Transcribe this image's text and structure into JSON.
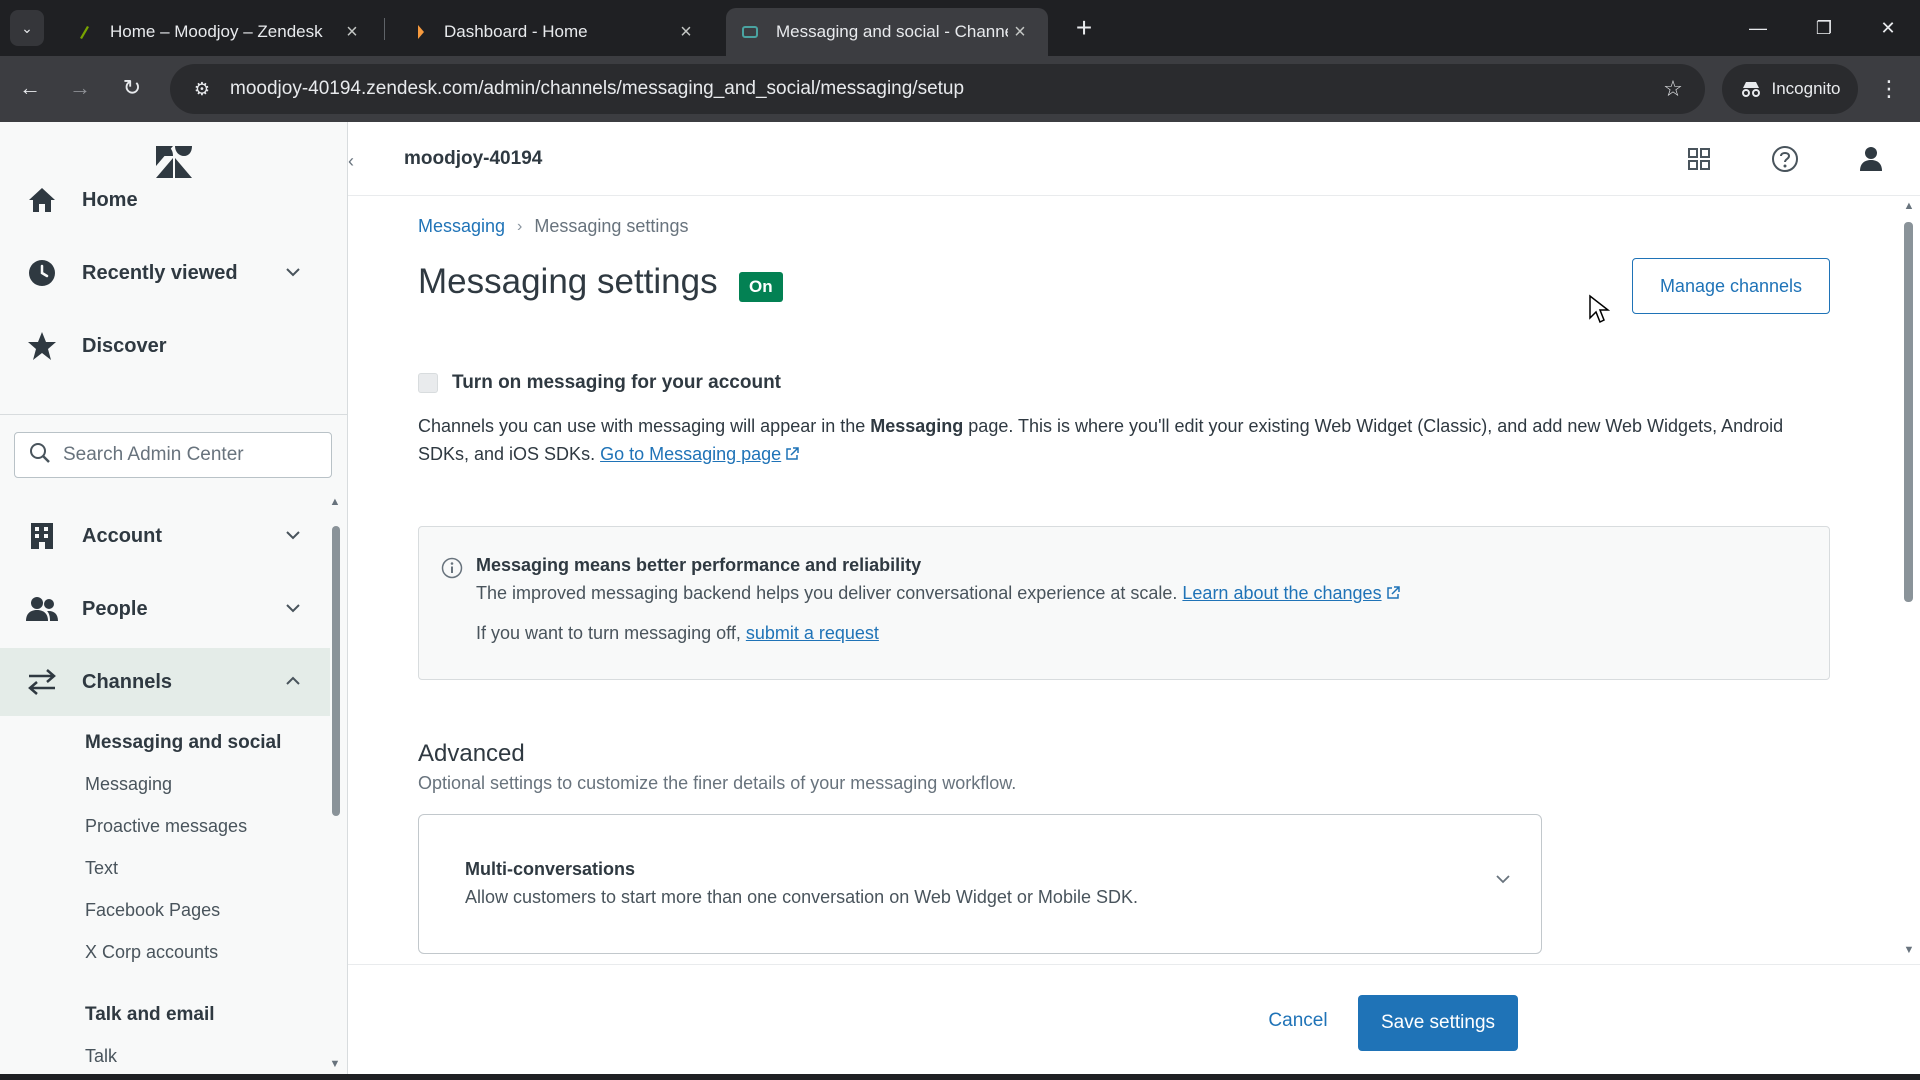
{
  "browser": {
    "tabs": [
      {
        "title": "Home – Moodjoy – Zendesk",
        "active": false
      },
      {
        "title": "Dashboard - Home",
        "active": false
      },
      {
        "title": "Messaging and social - Channe",
        "active": true
      }
    ],
    "url": "moodjoy-40194.zendesk.com/admin/channels/messaging_and_social/messaging/setup",
    "incognito_label": "Incognito"
  },
  "sidebar": {
    "nav": [
      {
        "label": "Home",
        "icon": "home-icon"
      },
      {
        "label": "Recently viewed",
        "icon": "clock-icon"
      },
      {
        "label": "Discover",
        "icon": "star-icon"
      }
    ],
    "search_placeholder": "Search Admin Center",
    "sections": [
      {
        "label": "Account",
        "icon": "building-icon"
      },
      {
        "label": "People",
        "icon": "people-icon"
      },
      {
        "label": "Channels",
        "icon": "arrows-icon",
        "expanded": true
      }
    ],
    "channels_sub": [
      {
        "label": "Messaging and social",
        "bold": true
      },
      {
        "label": "Messaging"
      },
      {
        "label": "Proactive messages"
      },
      {
        "label": "Text"
      },
      {
        "label": "Facebook Pages"
      },
      {
        "label": "X Corp accounts"
      },
      {
        "label": "Talk and email",
        "bold": true
      },
      {
        "label": "Talk"
      }
    ]
  },
  "header": {
    "subdomain": "moodjoy-40194"
  },
  "breadcrumb": {
    "parent": "Messaging",
    "current": "Messaging settings"
  },
  "page": {
    "title": "Messaging settings",
    "status_badge": "On",
    "manage_button": "Manage channels",
    "toggle_label": "Turn on messaging for your account",
    "desc_part1": "Channels you can use with messaging will appear in the ",
    "desc_bold": "Messaging",
    "desc_part2": " page. This is where you'll edit your existing Web Widget (Classic), and add new Web Widgets, Android SDKs, and iOS SDKs. ",
    "desc_link": "Go to Messaging page"
  },
  "notice": {
    "title": "Messaging means better performance and reliability",
    "body": "The improved messaging backend helps you deliver conversational experience at scale. ",
    "body_link": "Learn about the changes",
    "line2": "If you want to turn messaging off, ",
    "line2_link": "submit a request"
  },
  "advanced": {
    "title": "Advanced",
    "description": "Optional settings to customize the finer details of your messaging workflow.",
    "items": [
      {
        "title": "Multi-conversations",
        "description": "Allow customers to start more than one conversation on Web Widget or Mobile SDK."
      }
    ]
  },
  "footer": {
    "cancel": "Cancel",
    "save": "Save settings"
  },
  "colors": {
    "link": "#1f73b7",
    "badge_green": "#038153",
    "active_nav_bg": "#e4ece8"
  }
}
